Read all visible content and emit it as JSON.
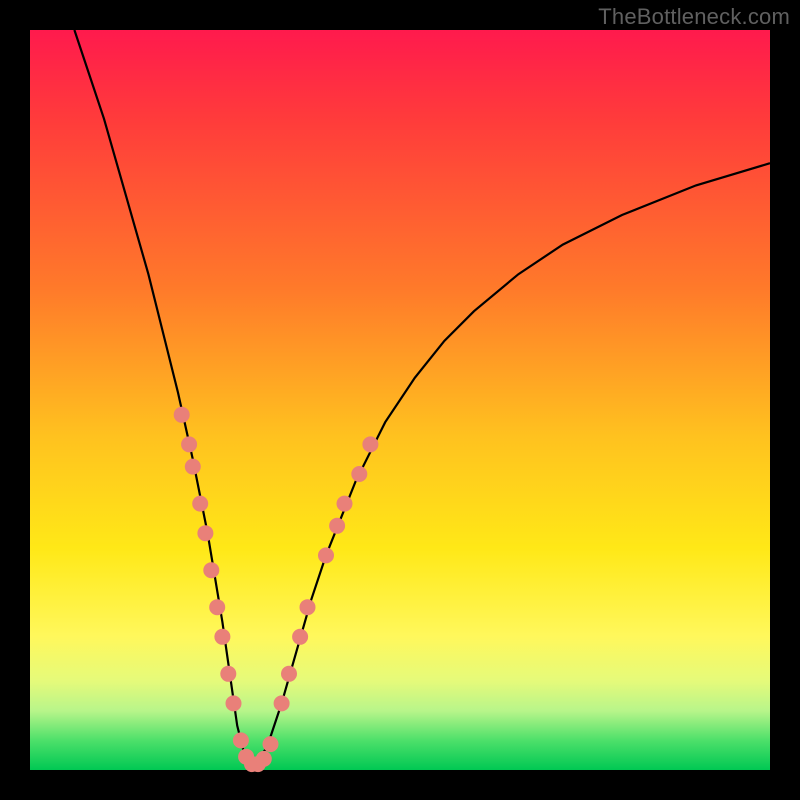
{
  "watermark": "TheBottleneck.com",
  "colors": {
    "gradient_top": "#ff1a4d",
    "gradient_bottom": "#00c853",
    "curve": "#000000",
    "dots": "#e98079",
    "frame": "#000000"
  },
  "chart_data": {
    "type": "line",
    "title": "",
    "xlabel": "",
    "ylabel": "",
    "xlim": [
      0,
      100
    ],
    "ylim": [
      0,
      100
    ],
    "series": [
      {
        "name": "curve",
        "x": [
          6,
          8,
          10,
          12,
          14,
          16,
          18,
          20,
          22,
          24,
          25,
          26,
          27,
          28,
          29,
          30,
          32,
          34,
          36,
          38,
          40,
          44,
          48,
          52,
          56,
          60,
          66,
          72,
          80,
          90,
          100
        ],
        "y": [
          100,
          94,
          88,
          81,
          74,
          67,
          59,
          51,
          42,
          32,
          26,
          20,
          13,
          6,
          2,
          0.5,
          3,
          9,
          16,
          23,
          29,
          39,
          47,
          53,
          58,
          62,
          67,
          71,
          75,
          79,
          82
        ]
      }
    ],
    "scatter_points": [
      {
        "x": 20.5,
        "y": 48
      },
      {
        "x": 21.5,
        "y": 44
      },
      {
        "x": 22.0,
        "y": 41
      },
      {
        "x": 23.0,
        "y": 36
      },
      {
        "x": 23.7,
        "y": 32
      },
      {
        "x": 24.5,
        "y": 27
      },
      {
        "x": 25.3,
        "y": 22
      },
      {
        "x": 26.0,
        "y": 18
      },
      {
        "x": 26.8,
        "y": 13
      },
      {
        "x": 27.5,
        "y": 9
      },
      {
        "x": 28.5,
        "y": 4
      },
      {
        "x": 29.2,
        "y": 1.8
      },
      {
        "x": 30.0,
        "y": 0.8
      },
      {
        "x": 30.8,
        "y": 0.8
      },
      {
        "x": 31.6,
        "y": 1.5
      },
      {
        "x": 32.5,
        "y": 3.5
      },
      {
        "x": 34.0,
        "y": 9
      },
      {
        "x": 35.0,
        "y": 13
      },
      {
        "x": 36.5,
        "y": 18
      },
      {
        "x": 37.5,
        "y": 22
      },
      {
        "x": 40.0,
        "y": 29
      },
      {
        "x": 41.5,
        "y": 33
      },
      {
        "x": 42.5,
        "y": 36
      },
      {
        "x": 44.5,
        "y": 40
      },
      {
        "x": 46.0,
        "y": 44
      }
    ]
  }
}
